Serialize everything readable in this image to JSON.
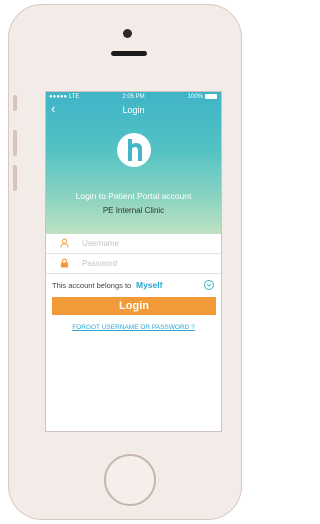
{
  "status_bar": {
    "carrier": "●●●●● LTE",
    "time": "2:05 PM",
    "battery": "100%"
  },
  "nav": {
    "title": "Login",
    "back_icon": "chevron-left-icon"
  },
  "hero": {
    "title": "Login to Patient Portal account",
    "clinic": "PE Internal Clinic",
    "logo_icon": "h-logo-icon"
  },
  "form": {
    "username_placeholder": "Username",
    "password_placeholder": "Password",
    "belongs_label": "This account belongs to",
    "belongs_value": "Myself",
    "login_label": "Login",
    "forgot_label": "FORGOT USERNAME OR PASSWORD ?"
  },
  "colors": {
    "accent": "#2aa6d4",
    "button": "#f29a37",
    "hero_top": "#3fb4c7",
    "lock": "#f29a37"
  }
}
